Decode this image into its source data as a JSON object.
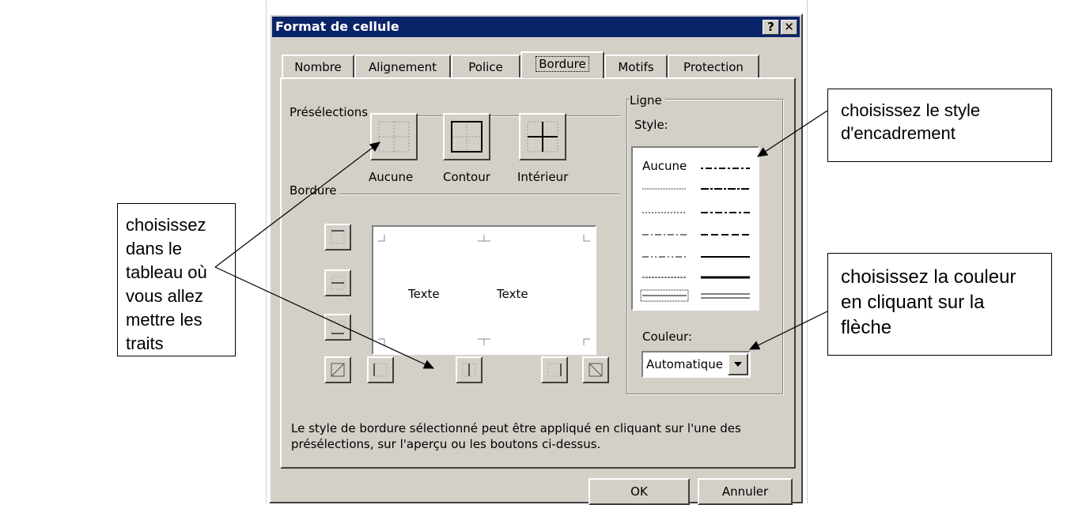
{
  "dialog": {
    "title": "Format de cellule",
    "help_button": "?",
    "close_button": "✕",
    "tabs": [
      {
        "label": "Nombre",
        "active": false
      },
      {
        "label": "Alignement",
        "active": false
      },
      {
        "label": "Police",
        "active": false
      },
      {
        "label": "Bordure",
        "active": true
      },
      {
        "label": "Motifs",
        "active": false
      },
      {
        "label": "Protection",
        "active": false
      }
    ],
    "presets": {
      "group_label": "Présélections",
      "buttons": [
        {
          "label": "Aucune",
          "icon": "border-none-icon"
        },
        {
          "label": "Contour",
          "icon": "border-outline-icon"
        },
        {
          "label": "Intérieur",
          "icon": "border-inside-icon"
        }
      ]
    },
    "border": {
      "group_label": "Bordure",
      "preview_text_left": "Texte",
      "preview_text_right": "Texte"
    },
    "line": {
      "group_label": "Ligne",
      "style_label": "Style:",
      "style_none": "Aucune",
      "color_label": "Couleur:",
      "color_value": "Automatique"
    },
    "description": "Le style de bordure sélectionné peut être appliqué en cliquant sur l'une des présélections, sur l'aperçu ou les boutons ci-dessus.",
    "ok_button": "OK",
    "cancel_button": "Annuler"
  },
  "callouts": {
    "left": "choisissez dans le tableau où vous allez mettre les traits",
    "top_right": "choisissez le style d'encadrement",
    "bottom_right": "choisissez la couleur en cliquant sur la flèche"
  },
  "colors": {
    "titlebar": "#0a246a",
    "dialog_face": "#d4d0c8"
  }
}
